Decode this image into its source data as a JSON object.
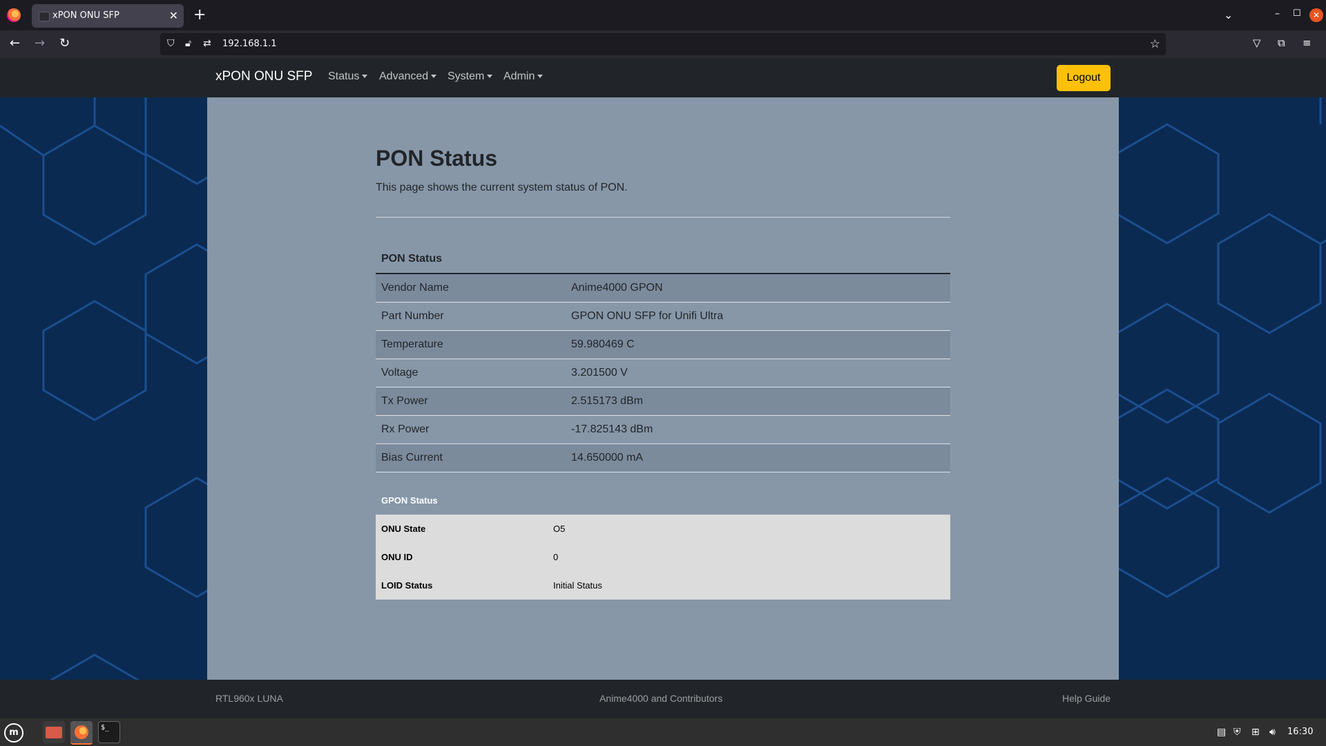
{
  "browser": {
    "tab_title": "xPON ONU SFP",
    "tab_close": "✕",
    "new_tab": "+",
    "url": "192.168.1.1"
  },
  "nav": {
    "brand": "xPON ONU SFP",
    "menus": [
      "Status",
      "Advanced",
      "System",
      "Admin"
    ],
    "logout": "Logout"
  },
  "page": {
    "title": "PON Status",
    "description": "This page shows the current system status of PON."
  },
  "pon_status": {
    "caption": "PON Status",
    "rows": [
      {
        "label": "Vendor Name",
        "value": "Anime4000 GPON"
      },
      {
        "label": "Part Number",
        "value": "GPON ONU SFP for Unifi Ultra"
      },
      {
        "label": "Temperature",
        "value": "59.980469 C"
      },
      {
        "label": "Voltage",
        "value": "3.201500 V"
      },
      {
        "label": "Tx Power",
        "value": "2.515173 dBm"
      },
      {
        "label": "Rx Power",
        "value": "-17.825143 dBm"
      },
      {
        "label": "Bias Current",
        "value": "14.650000 mA"
      }
    ]
  },
  "gpon_status": {
    "caption": "GPON Status",
    "rows": [
      {
        "label": "ONU State",
        "value": "O5"
      },
      {
        "label": "ONU ID",
        "value": "0"
      },
      {
        "label": "LOID Status",
        "value": "Initial Status"
      }
    ]
  },
  "footer": {
    "left": "RTL960x LUNA",
    "center": "Anime4000 and Contributors",
    "right": "Help Guide"
  },
  "taskbar": {
    "clock": "16:30",
    "terminal_glyph": "$_"
  },
  "colors": {
    "navbar": "#212529",
    "logout": "#ffc107",
    "container": "#8797a8",
    "background": "#0b2a52",
    "hex_stroke": "#1b4f8f"
  }
}
